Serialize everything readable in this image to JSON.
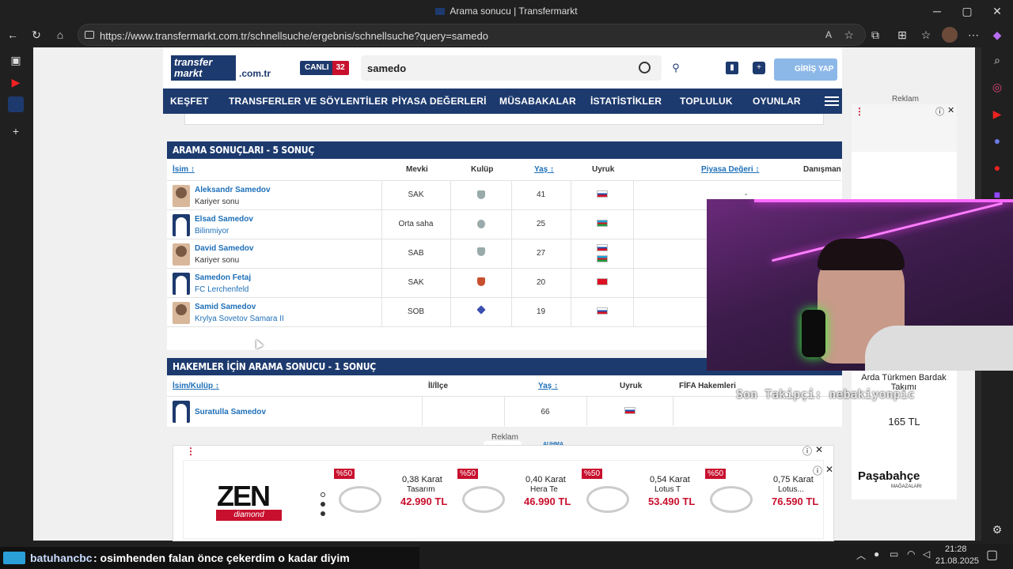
{
  "browser": {
    "tab_title": "Arama sonucu | Transfermarkt",
    "url": "https://www.transfermarkt.com.tr/schnellsuche/ergebnis/schnellsuche?query=samedo"
  },
  "header": {
    "logo_text": "transfer markt",
    "logo_tld": ".com.tr",
    "live_label": "CANLI",
    "live_count": "32",
    "search_value": "samedo",
    "login_label": "GİRİŞ YAP"
  },
  "nav": [
    "KEŞFET",
    "TRANSFERLER VE SÖYLENTİLER",
    "PİYASA DEĞERLERİ",
    "MÜSABAKALAR",
    "İSTATİSTİKLER",
    "TOPLULUK",
    "OYUNLAR"
  ],
  "players": {
    "title": "ARAMA SONUÇLARI - 5 SONUÇ",
    "headers": {
      "name": "İsim",
      "position": "Mevki",
      "club": "Kulüp",
      "age": "Yaş",
      "nation": "Uyruk",
      "value": "Piyasa Değeri",
      "agent": "Danışman"
    },
    "rows": [
      {
        "name": "Aleksandr Samedov",
        "sub": "Kariyer sonu",
        "position": "SAK",
        "age": "41",
        "value": "-"
      },
      {
        "name": "Elsad Samedov",
        "sub": "Bilinmiyor",
        "position": "Orta saha",
        "age": "25",
        "value": ""
      },
      {
        "name": "David Samedov",
        "sub": "Kariyer sonu",
        "position": "SAB",
        "age": "27",
        "value": ""
      },
      {
        "name": "Samedon Fetaj",
        "sub": "FC Lerchenfeld",
        "position": "SAK",
        "age": "20",
        "value": ""
      },
      {
        "name": "Samid Samedov",
        "sub": "Krylya Sovetov Samara II",
        "position": "SOB",
        "age": "19",
        "value": ""
      }
    ]
  },
  "referees": {
    "title": "HAKEMLER İÇİN ARAMA SONUCU - 1 SONUÇ",
    "headers": {
      "name": "İsim/Kulüp",
      "city": "İl/İlçe",
      "age": "Yaş",
      "nation": "Uyruk",
      "fifa": "FİFA Hakemleri"
    },
    "rows": [
      {
        "name": "Suratulla Samedov",
        "age": "66"
      }
    ]
  },
  "ads": {
    "reklam": "Reklam",
    "brand": "ZEN",
    "brand_sub": "diamond",
    "badge": "%50",
    "products": [
      {
        "name": "0,38 Karat",
        "name2": "Tasarım",
        "price": "42.990 TL"
      },
      {
        "name": "0,40 Karat",
        "name2": "Hera Te",
        "price": "46.990 TL"
      },
      {
        "name": "0,54 Karat",
        "name2": "Lotus T",
        "price": "53.490 TL"
      },
      {
        "name": "0,75 Karat",
        "name2": "Lotus...",
        "price": "76.590 TL"
      }
    ],
    "auhma": "AUHMA",
    "side_product": "Arda Türkmen Bardak Takımı",
    "side_price": "165 TL",
    "side_brand": "Paşabahçe",
    "side_brand_sub": "MAĞAZALARI"
  },
  "overlay": {
    "follower": "Son Takipçi: nebakiyonpic",
    "chat_user": "batuhancbc",
    "chat_msg": ": osimhenden falan önce çekerdim o kadar diyim"
  },
  "taskbar": {
    "time": "21:28",
    "date": "21.08.2025"
  }
}
